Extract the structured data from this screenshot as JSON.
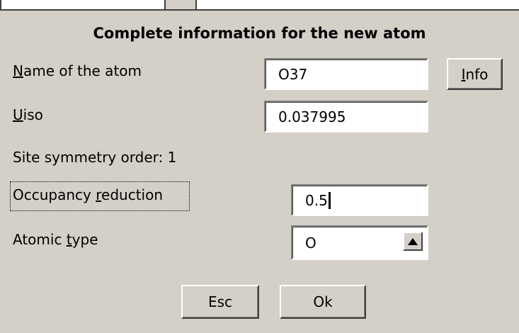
{
  "dialog": {
    "title": "Complete information for the new atom"
  },
  "fields": {
    "name": {
      "mnemonic": "N",
      "label_rest": "ame of the atom",
      "value": "O37"
    },
    "uiso": {
      "mnemonic": "U",
      "label_rest": "iso",
      "value": "0.037995"
    },
    "site_symmetry": {
      "label": "Site symmetry order:",
      "value": "1"
    },
    "occupancy": {
      "label_pre": "Occupancy ",
      "mnemonic": "r",
      "label_rest": "eduction",
      "value": "0.5"
    },
    "atomic_type": {
      "label_pre": "Atomic ",
      "mnemonic": "t",
      "label_rest": "ype",
      "value": "O"
    }
  },
  "buttons": {
    "info": {
      "mnemonic": "I",
      "label_rest": "nfo"
    },
    "esc": "Esc",
    "ok": "Ok"
  },
  "icons": {
    "dropdown": "triangle-up-icon"
  }
}
